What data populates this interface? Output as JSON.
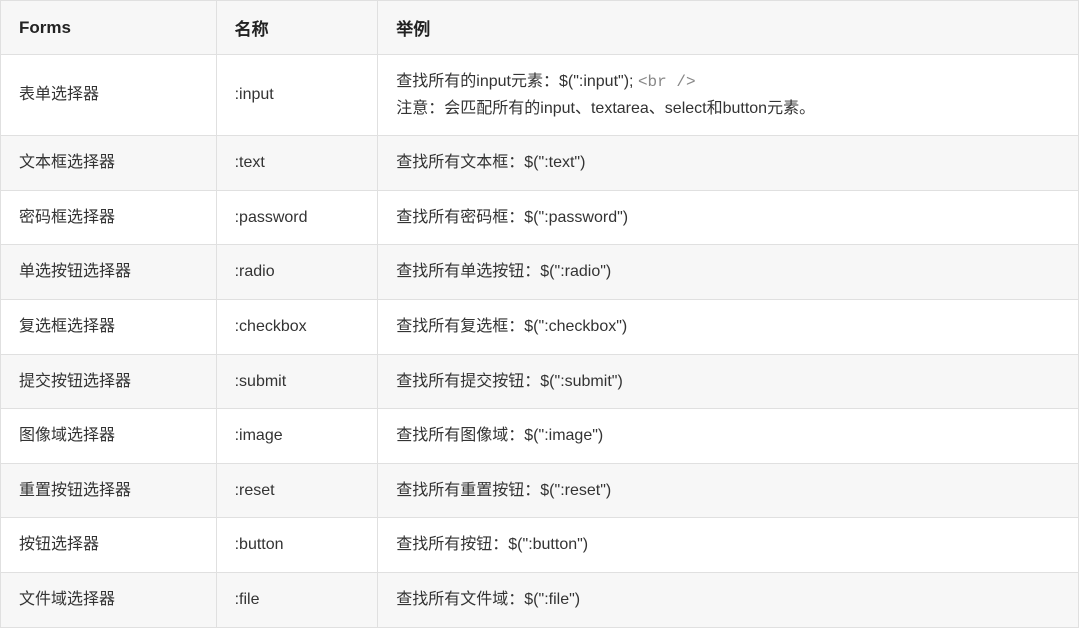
{
  "table": {
    "headers": {
      "forms": "Forms",
      "name": "名称",
      "example": "举例"
    },
    "rows": [
      {
        "forms": "表单选择器",
        "name": ":input",
        "example_line1_pre": "查找所有的input元素：$(\":input\"); ",
        "example_line1_code": "<br />",
        "example_line2": "注意：会匹配所有的input、textarea、select和button元素。",
        "multiline": true
      },
      {
        "forms": "文本框选择器",
        "name": ":text",
        "example": "查找所有文本框：$(\":text\")"
      },
      {
        "forms": "密码框选择器",
        "name": ":password",
        "example": "查找所有密码框：$(\":password\")"
      },
      {
        "forms": "单选按钮选择器",
        "name": ":radio",
        "example": "查找所有单选按钮：$(\":radio\")"
      },
      {
        "forms": "复选框选择器",
        "name": ":checkbox",
        "example": "查找所有复选框：$(\":checkbox\")"
      },
      {
        "forms": "提交按钮选择器",
        "name": ":submit",
        "example": "查找所有提交按钮：$(\":submit\")"
      },
      {
        "forms": "图像域选择器",
        "name": ":image",
        "example": "查找所有图像域：$(\":image\")"
      },
      {
        "forms": "重置按钮选择器",
        "name": ":reset",
        "example": "查找所有重置按钮：$(\":reset\")"
      },
      {
        "forms": "按钮选择器",
        "name": ":button",
        "example": "查找所有按钮：$(\":button\")"
      },
      {
        "forms": "文件域选择器",
        "name": ":file",
        "example": "查找所有文件域：$(\":file\")"
      }
    ]
  }
}
